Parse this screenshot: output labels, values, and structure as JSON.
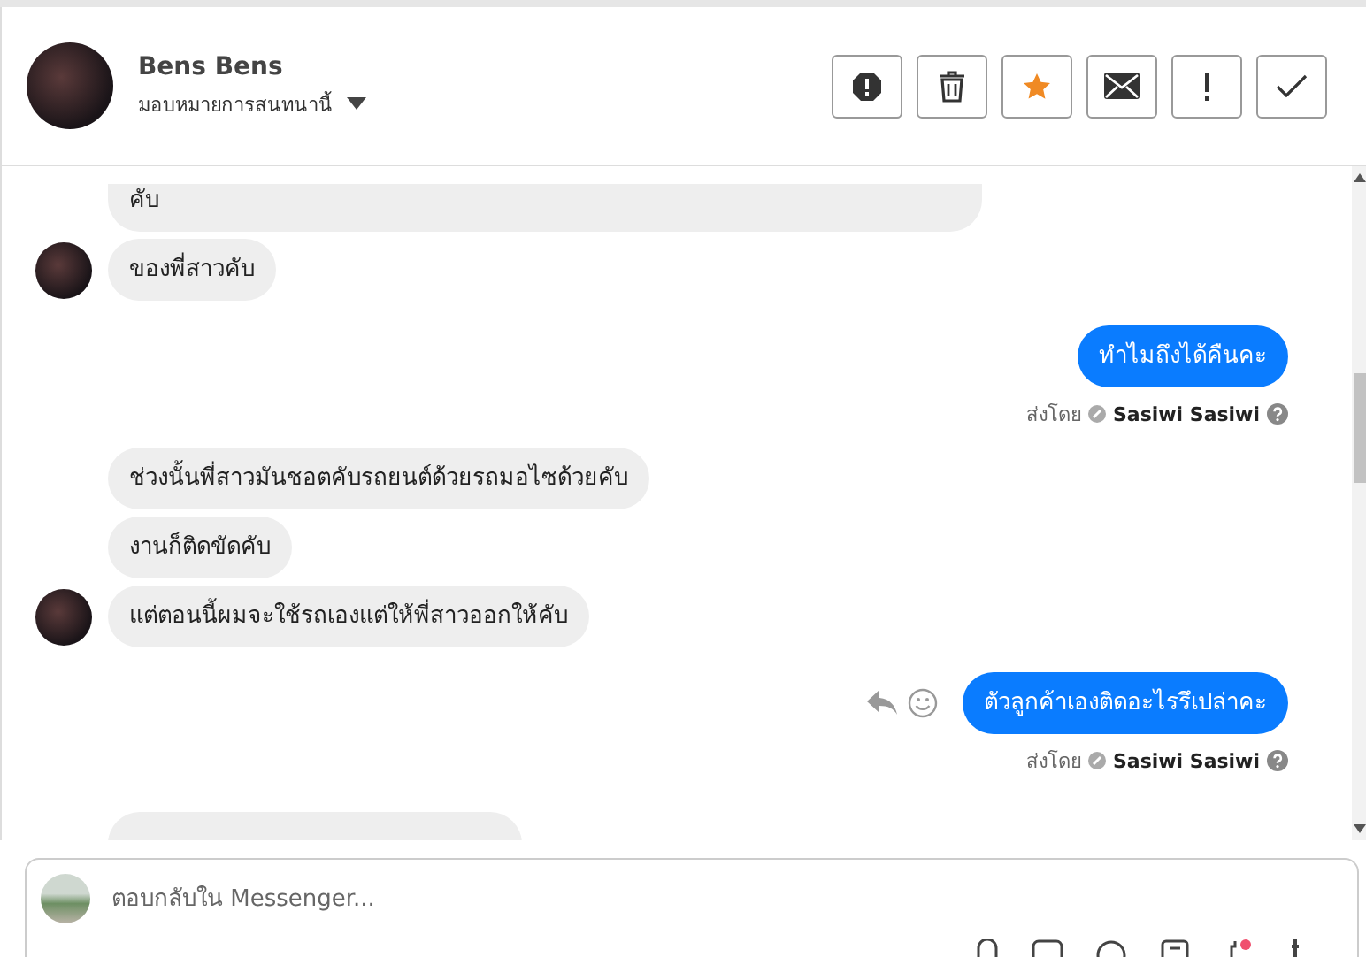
{
  "header": {
    "name": "Bens Bens",
    "assign_label": "มอบหมายการสนทนานี้",
    "actions": [
      {
        "kind": "alert"
      },
      {
        "kind": "trash"
      },
      {
        "kind": "star",
        "selected": true
      },
      {
        "kind": "mail"
      },
      {
        "kind": "exclaim"
      },
      {
        "kind": "check"
      }
    ]
  },
  "messages": [
    {
      "kind": "incoming",
      "texts": [
        "คับ",
        "ของพี่สาวคับ"
      ]
    },
    {
      "kind": "outgoing",
      "text": "ทำไมถึงได้คืนคะ",
      "sent_by_label": "ส่งโดย",
      "sender": "Sasiwi Sasiwi",
      "hover_actions": false
    },
    {
      "kind": "incoming",
      "texts": [
        "ช่วงนั้นพี่สาวมันชอตคับรถยนต์ด้วยรถมอไซด้วยคับ",
        "งานก็ติดขัดคับ",
        "แต่ตอนนี้ผมจะใช้รถเองแต่ให้พี่สาวออกให้คับ"
      ]
    },
    {
      "kind": "outgoing",
      "text": "ตัวลูกค้าเองติดอะไรรึเปล่าคะ",
      "sent_by_label": "ส่งโดย",
      "sender": "Sasiwi Sasiwi",
      "hover_actions": true
    }
  ],
  "composer": {
    "placeholder": "ตอบกลับใน Messenger..."
  }
}
